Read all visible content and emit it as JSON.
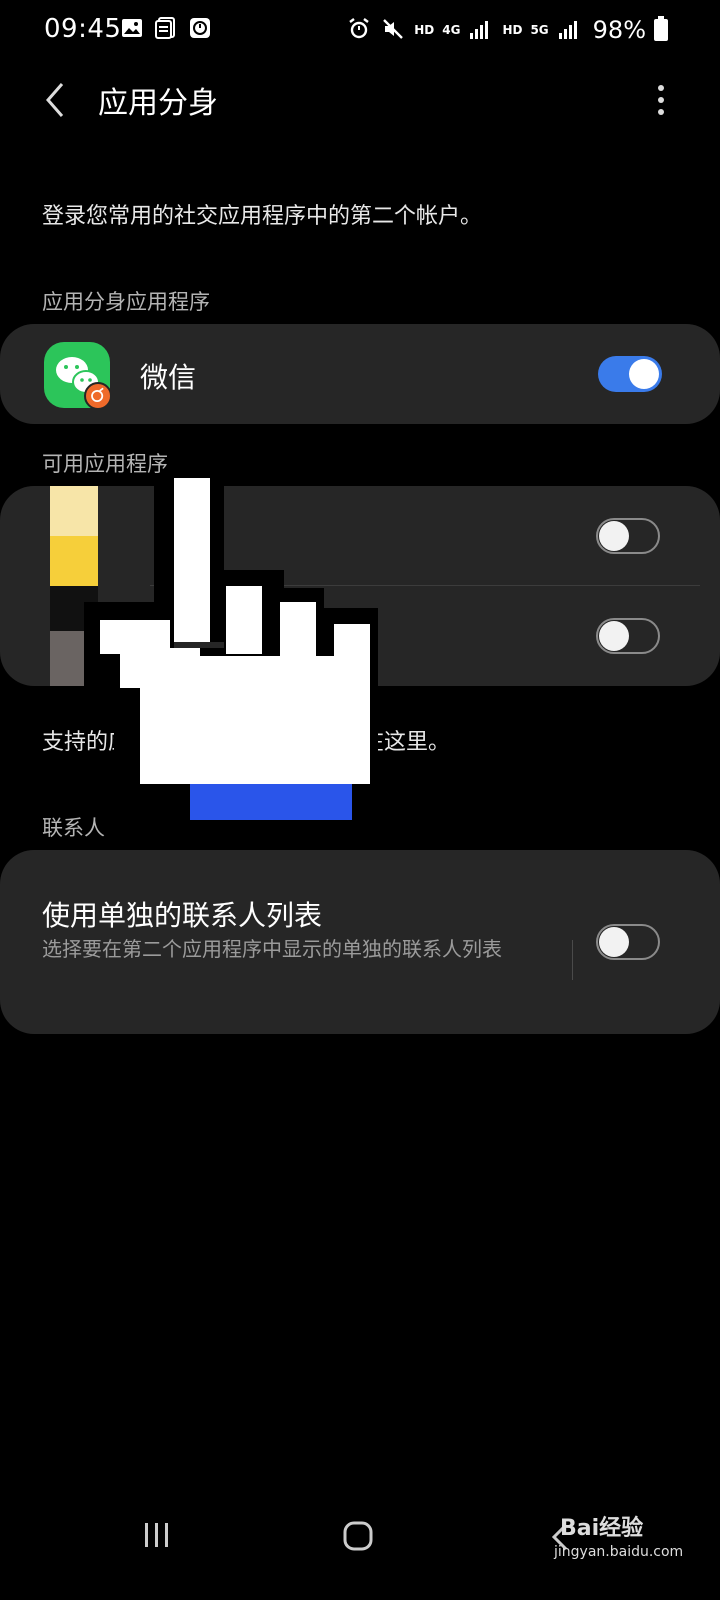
{
  "status_bar": {
    "time": "09:45",
    "battery_text": "98%",
    "network_labels": [
      "HD",
      "4G",
      "HD",
      "5G"
    ],
    "left_icons": [
      "image-icon",
      "document-icon",
      "clock-app-icon"
    ],
    "right_icons": [
      "alarm-icon",
      "mute-icon",
      "signal-icon",
      "signal-icon",
      "battery-icon"
    ]
  },
  "header": {
    "title": "应用分身",
    "back_icon": "chevron-left-icon",
    "more_icon": "more-vertical-icon"
  },
  "description": "登录您常用的社交应用程序中的第二个帐户。",
  "cloned_section": {
    "header": "应用分身应用程序",
    "items": [
      {
        "label": "微信",
        "icon": "wechat-icon",
        "enabled": true
      }
    ]
  },
  "available_section": {
    "header": "可用应用程序",
    "items": [
      {
        "enabled": false
      },
      {
        "enabled": false
      }
    ]
  },
  "support_text": {
    "prefix": "支持的应",
    "suffix": "在这里。"
  },
  "contacts_section": {
    "header": "联系人",
    "title": "使用单独的联系人列表",
    "description": "选择要在第二个应用程序中显示的单独的联系人列表",
    "enabled": false
  },
  "nav_bar": {
    "icons": [
      "recents-icon",
      "home-icon",
      "back-icon"
    ]
  },
  "watermark": {
    "text": "Bai经验",
    "sub": "jingyan.baidu.com"
  },
  "colors": {
    "background": "#000000",
    "card": "#262626",
    "accent": "#3a7bea",
    "wechat_green": "#2cc55a",
    "badge_orange": "#ef6a2a"
  }
}
